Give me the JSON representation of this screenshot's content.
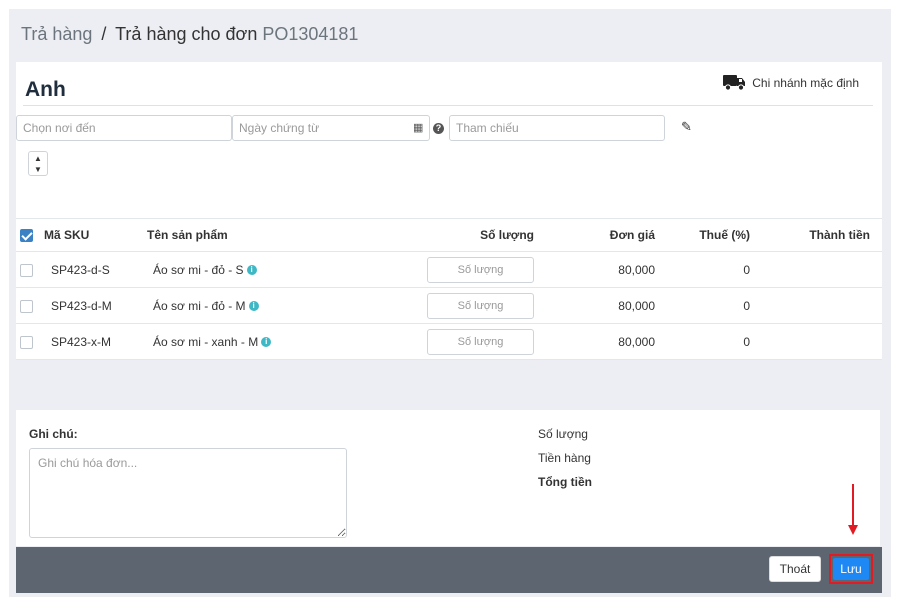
{
  "breadcrumb": {
    "root": "Trả hàng",
    "separator": "/",
    "current_prefix": "Trả hàng cho đơn",
    "order_code": "PO1304181"
  },
  "supplier_name": "Anh",
  "branch": {
    "icon": "truck-icon",
    "label": "Chi nhánh mặc định"
  },
  "filters": {
    "destination_placeholder": "Chọn nơi đến",
    "date_placeholder": "Ngày chứng từ",
    "reference_placeholder": "Tham chiếu"
  },
  "table": {
    "headers": {
      "sku": "Mã SKU",
      "name": "Tên sản phẩm",
      "qty": "Số lượng",
      "price": "Đơn giá",
      "tax": "Thuế (%)",
      "total": "Thành tiền"
    },
    "header_checked": true,
    "qty_placeholder": "Số lượng",
    "rows": [
      {
        "sku": "SP423-d-S",
        "name": "Áo sơ mi - đỏ - S",
        "price": "80,000",
        "tax": "0",
        "total": ""
      },
      {
        "sku": "SP423-d-M",
        "name": "Áo sơ mi - đỏ - M",
        "price": "80,000",
        "tax": "0",
        "total": ""
      },
      {
        "sku": "SP423-x-M",
        "name": "Áo sơ mi - xanh - M",
        "price": "80,000",
        "tax": "0",
        "total": ""
      }
    ]
  },
  "note": {
    "label": "Ghi chú:",
    "placeholder": "Ghi chú hóa đơn..."
  },
  "summary": {
    "qty_label": "Số lượng",
    "goods_label": "Tiền hàng",
    "total_label": "Tổng tiền"
  },
  "footer": {
    "exit_label": "Thoát",
    "save_label": "Lưu"
  },
  "colors": {
    "primary": "#1e88f5",
    "highlight": "#e01b24",
    "footer_bg": "#5d6571",
    "info": "#3fb8c6"
  }
}
